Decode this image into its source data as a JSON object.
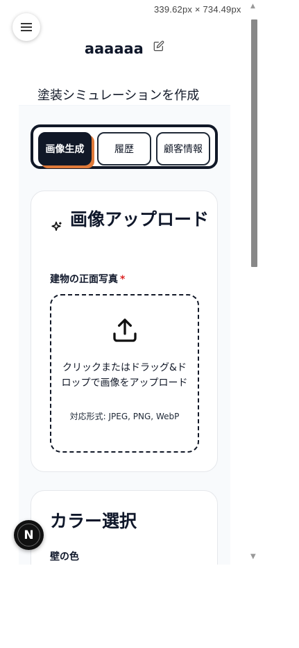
{
  "viewport_label": "339.62px × 734.49px",
  "header": {
    "username": "aaaaaa",
    "page_title": "塗装シミュレーションを作成"
  },
  "tabs": [
    {
      "label": "画像生成",
      "active": true
    },
    {
      "label": "履歴",
      "active": false
    },
    {
      "label": "顧客情報",
      "active": false
    }
  ],
  "upload_card": {
    "title": "画像アップロード",
    "field_label": "建物の正面写真",
    "required_mark": "*",
    "dropzone_text": "クリックまたはドラッグ&ドロップで画像をアップロード",
    "formats": "対応形式: JPEG, PNG, WebP"
  },
  "color_card": {
    "title": "カラー選択",
    "wall_label": "壁の色"
  },
  "fab_label": "N",
  "colors": {
    "primary": "#111827",
    "accent_shadow": "#e07a3a",
    "required": "#dc2626"
  }
}
